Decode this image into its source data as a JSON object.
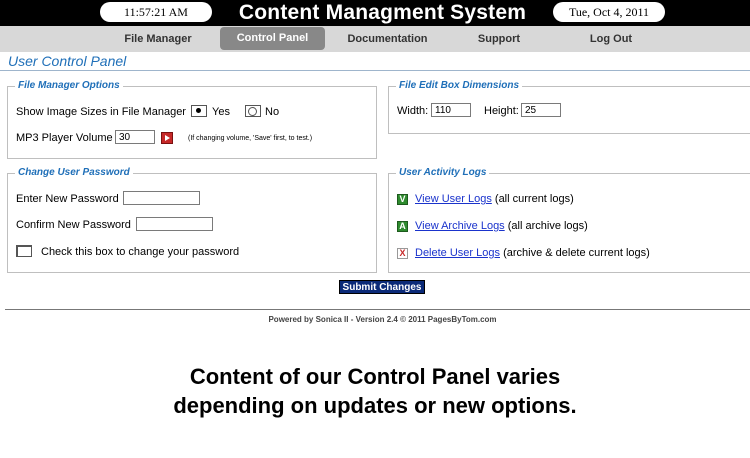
{
  "header": {
    "time": "11:57:21 AM",
    "title": "Content Managment System",
    "date": "Tue, Oct 4, 2011"
  },
  "nav": {
    "items": [
      "File Manager",
      "Control Panel",
      "Documentation",
      "Support",
      "Log Out"
    ],
    "active": "Control Panel"
  },
  "page": {
    "heading": "User Control Panel"
  },
  "file_manager_options": {
    "legend": "File Manager Options",
    "show_sizes_label": "Show Image Sizes in File Manager",
    "yes_label": "Yes",
    "no_label": "No",
    "selected": "Yes",
    "mp3_label": "MP3 Player Volume",
    "mp3_value": "30",
    "mp3_note": "(If changing volume, 'Save' first, to test.)"
  },
  "file_edit_box": {
    "legend": "File Edit Box Dimensions",
    "width_label": "Width:",
    "width_value": "110",
    "height_label": "Height:",
    "height_value": "25"
  },
  "change_password": {
    "legend": "Change User Password",
    "new_label": "Enter New Password",
    "confirm_label": "Confirm New Password",
    "checkbox_label": "Check this box to change your password"
  },
  "activity_logs": {
    "legend": "User Activity Logs",
    "items": [
      {
        "icon": "V",
        "link": "View User Logs",
        "note": "(all current logs)"
      },
      {
        "icon": "A",
        "link": "View Archive Logs",
        "note": "(all archive logs)"
      },
      {
        "icon": "X",
        "link": "Delete User Logs",
        "note": "(archive & delete current logs)"
      }
    ]
  },
  "submit_label": "Submit Changes",
  "footer": "Powered by Sonica II - Version 2.4 © 2011 PagesByTom.com",
  "caption": {
    "line1": "Content of our Control Panel varies",
    "line2": "depending on updates or new options."
  },
  "colors": {
    "heading_blue": "#1f6fb8",
    "link_blue": "#1a33cc",
    "submit_navy": "#0b2a78",
    "view_green": "#2e8b2e",
    "delete_red": "#c62828"
  }
}
